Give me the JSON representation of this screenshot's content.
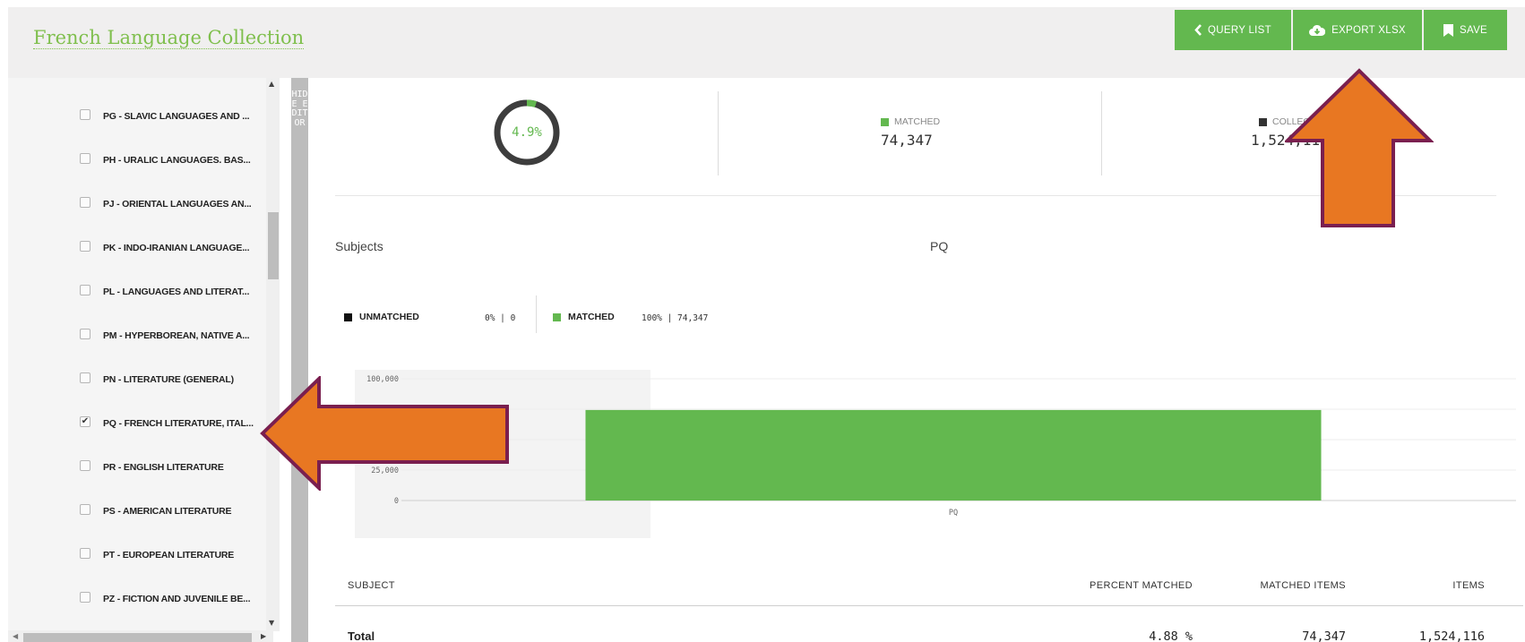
{
  "app": {
    "title": "French Language Collection"
  },
  "toolbar": {
    "query_list_label": "QUERY LIST",
    "export_label": "EXPORT XLSX",
    "save_label": "SAVE",
    "button_color": "#63b84f"
  },
  "sidebar": {
    "items": [
      {
        "label": "PG - SLAVIC LANGUAGES AND ...",
        "checked": false
      },
      {
        "label": "PH - URALIC LANGUAGES. BAS...",
        "checked": false
      },
      {
        "label": "PJ - ORIENTAL LANGUAGES AN...",
        "checked": false
      },
      {
        "label": "PK - INDO-IRANIAN LANGUAGE...",
        "checked": false
      },
      {
        "label": "PL - LANGUAGES AND LITERAT...",
        "checked": false
      },
      {
        "label": "PM - HYPERBOREAN, NATIVE A...",
        "checked": false
      },
      {
        "label": "PN - LITERATURE (GENERAL)",
        "checked": false
      },
      {
        "label": "PQ - FRENCH LITERATURE, ITAL...",
        "checked": true
      },
      {
        "label": "PR - ENGLISH LITERATURE",
        "checked": false
      },
      {
        "label": "PS - AMERICAN LITERATURE",
        "checked": false
      },
      {
        "label": "PT - EUROPEAN LITERATURE",
        "checked": false
      },
      {
        "label": "PZ - FICTION AND JUVENILE BE...",
        "checked": false
      }
    ]
  },
  "hide_editor_label": "HIDE EDITOR",
  "summary": {
    "percent_label": "4.9%",
    "percent_value": 0.049,
    "matched_label": "MATCHED",
    "matched_value": "74,347",
    "collection_label": "COLLECTION",
    "collection_value": "1,524,116"
  },
  "section": {
    "left_label": "Subjects",
    "center_label": "PQ"
  },
  "legend": {
    "unmatched_label": "UNMATCHED",
    "unmatched_value": "0% | 0",
    "matched_label": "MATCHED",
    "matched_value": "100% | 74,347"
  },
  "chart_data": {
    "type": "bar",
    "categories": [
      "PQ"
    ],
    "series": [
      {
        "name": "MATCHED",
        "values": [
          74347
        ]
      }
    ],
    "ylim": [
      0,
      100000
    ],
    "yticks": [
      0,
      25000,
      50000,
      75000,
      100000
    ],
    "ytick_labels": [
      "0",
      "25,000",
      "50,000",
      "75,000",
      "100,000"
    ],
    "grid": true,
    "bar_color": "#63b84f"
  },
  "table": {
    "headers": [
      "SUBJECT",
      "PERCENT MATCHED",
      "MATCHED ITEMS",
      "ITEMS"
    ],
    "rows": [
      {
        "subject": "Total",
        "percent": "4.88 %",
        "matched": "74,347",
        "items": "1,524,116"
      }
    ]
  },
  "colors": {
    "accent_green": "#63b84f",
    "title_green": "#7fbf4d",
    "annotation_arrow": "#e87722",
    "annotation_border": "#7a1f4f"
  }
}
